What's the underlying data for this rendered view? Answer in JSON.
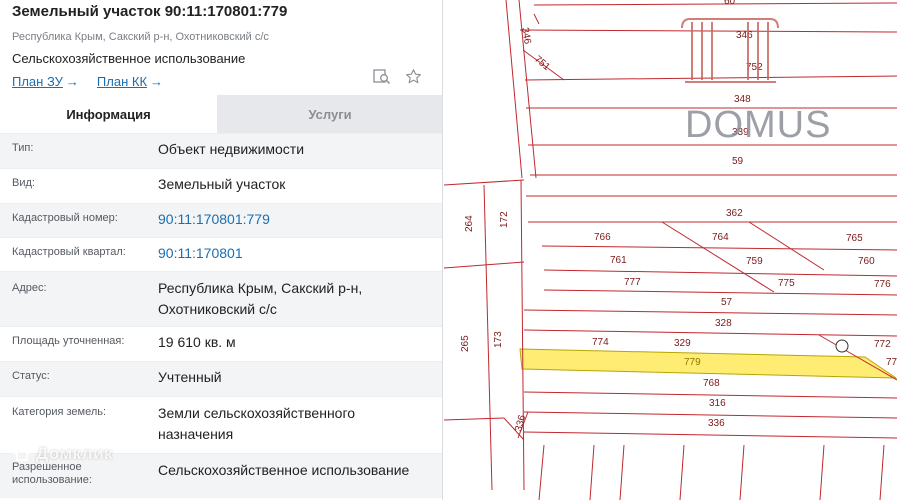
{
  "header": {
    "title": "Земельный участок 90:11:170801:779",
    "address_short": "Республика Крым, Сакский р-н, Охотниковский с/с",
    "usage": "Сельскохозяйственное использование",
    "links": [
      {
        "label": "План ЗУ",
        "arrow": "→"
      },
      {
        "label": "План КК",
        "arrow": "→"
      }
    ],
    "icons": [
      "map-search-icon",
      "star-icon"
    ]
  },
  "tabs": [
    {
      "label": "Информация",
      "active": true
    },
    {
      "label": "Услуги",
      "active": false
    }
  ],
  "rows": [
    {
      "label": "Тип:",
      "value": "Объект недвижимости",
      "link": false
    },
    {
      "label": "Вид:",
      "value": "Земельный участок",
      "link": false
    },
    {
      "label": "Кадастровый номер:",
      "value": "90:11:170801:779",
      "link": true
    },
    {
      "label": "Кадастровый квартал:",
      "value": "90:11:170801",
      "link": true
    },
    {
      "label": "Адрес:",
      "value": "Республика Крым, Сакский р-н, Охотниковский с/с",
      "link": false
    },
    {
      "label": "Площадь уточненная:",
      "value": "19 610 кв. м",
      "link": false
    },
    {
      "label": "Статус:",
      "value": "Учтенный",
      "link": false
    },
    {
      "label": "Категория земель:",
      "value": "Земли сельскохозяйственного назначения",
      "link": false
    },
    {
      "label": "Разрешенное использование:",
      "value": "Сельскохозяйственное использование",
      "link": false
    }
  ],
  "map": {
    "highlight_color": "#ffec73",
    "line_color": "#c0282d",
    "labels": [
      "60",
      "346",
      "346",
      "751",
      "752",
      "348",
      "339",
      "59",
      "264",
      "172",
      "362",
      "766",
      "764",
      "765",
      "761",
      "759",
      "760",
      "777",
      "775",
      "776",
      "57",
      "328",
      "265",
      "173",
      "774",
      "329",
      "772",
      "779",
      "77",
      "768",
      "316",
      "336",
      "336"
    ],
    "watermark_brand": "DOMUS"
  },
  "watermark": "Домклик"
}
